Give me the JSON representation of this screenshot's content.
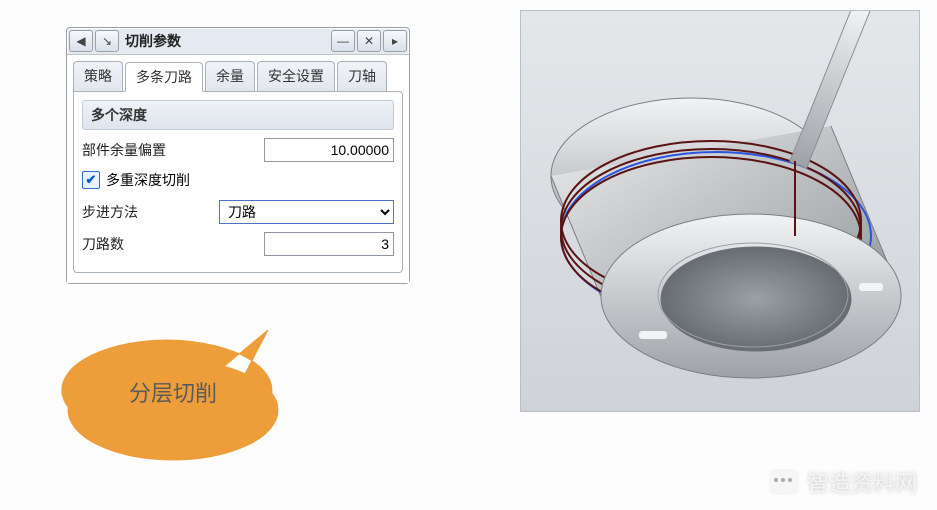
{
  "window": {
    "title": "切削参数",
    "nav_back": "◀",
    "nav_arrow": "↘",
    "minimize": "—",
    "close": "✕",
    "maximize": "▸"
  },
  "tabs": {
    "strategy": "策略",
    "multipath": "多条刀路",
    "stock": "余量",
    "safety": "安全设置",
    "toolaxis": "刀轴"
  },
  "group": {
    "header": "多个深度",
    "part_stock_offset_label": "部件余量偏置",
    "part_stock_offset_value": "10.00000",
    "multi_depth_cut_label": "多重深度切削",
    "multi_depth_cut_checked": "✔",
    "step_method_label": "步进方法",
    "step_method_value": "刀路",
    "passes_label": "刀路数",
    "passes_value": "3"
  },
  "callout": {
    "text": "分层切削"
  },
  "watermark": {
    "text": "智造资料网"
  }
}
